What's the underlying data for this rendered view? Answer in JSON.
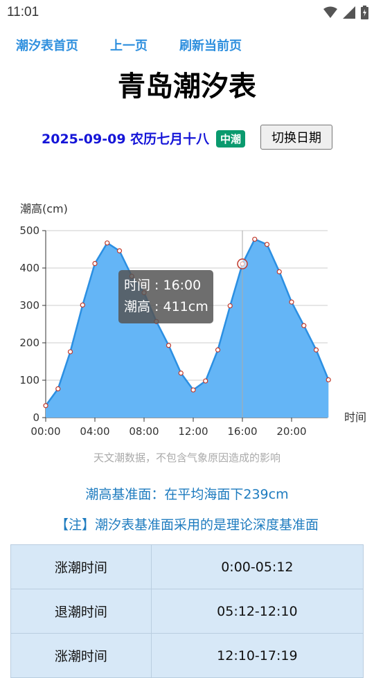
{
  "status": {
    "time": "11:01"
  },
  "nav": {
    "home": "潮汐表首页",
    "prev": "上一页",
    "refresh": "刷新当前页"
  },
  "title": "青岛潮汐表",
  "date_line": {
    "date": "2025-09-09 农历七月十八",
    "tide_type": "中潮",
    "switch_button": "切换日期"
  },
  "chart_data": {
    "type": "area",
    "ylabel": "潮高(cm)",
    "xlabel": "时间",
    "ylim": [
      0,
      500
    ],
    "y_ticks": [
      "0",
      "100",
      "200",
      "300",
      "400",
      "500"
    ],
    "x_ticks": [
      "00:00",
      "04:00",
      "08:00",
      "12:00",
      "16:00",
      "20:00"
    ],
    "x_hours": [
      0,
      1,
      2,
      3,
      4,
      5,
      6,
      7,
      8,
      9,
      10,
      11,
      12,
      13,
      14,
      15,
      16,
      17,
      18,
      19,
      20,
      21,
      22,
      23
    ],
    "values": [
      32,
      77,
      176,
      301,
      412,
      467,
      446,
      378,
      334,
      257,
      193,
      119,
      74,
      98,
      181,
      299,
      411,
      477,
      463,
      390,
      309,
      246,
      181,
      101
    ],
    "tooltip": {
      "time": "时间 : 16:00",
      "height": "潮高 : 411cm",
      "hour": 16
    },
    "fill_color": "#64b5f6",
    "line_color": "#2b8fe2"
  },
  "disclaimer": "天文潮数据，不包含气象原因造成的影响",
  "datum": "潮高基准面：在平均海面下239cm",
  "note": "【注】潮汐表基准面采用的是理论深度基准面",
  "tide_table": [
    {
      "label": "涨潮时间",
      "range": "0:00-05:12"
    },
    {
      "label": "退潮时间",
      "range": "05:12-12:10"
    },
    {
      "label": "涨潮时间",
      "range": "12:10-17:19"
    }
  ]
}
